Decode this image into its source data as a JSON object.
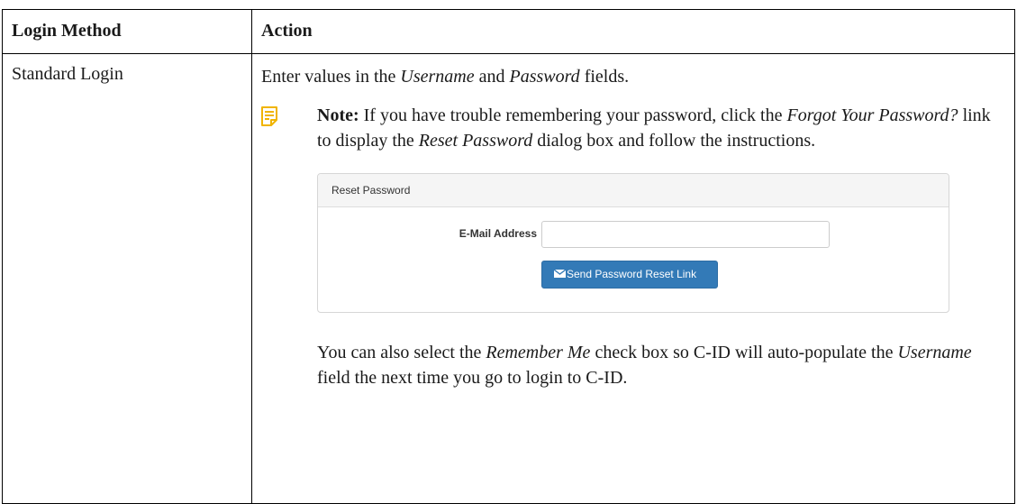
{
  "table": {
    "headers": [
      "Login Method",
      "Action"
    ],
    "row": {
      "method": "Standard Login",
      "intro": {
        "t1": "Enter values in the ",
        "e1": "Username",
        "t2": " and ",
        "e2": "Password",
        "t3": " fields."
      },
      "note": {
        "label": "Note:",
        "t1": " If you have trouble remembering your password, click the ",
        "e1": "Forgot Your Password?",
        "t2": " link to display the ",
        "e2": "Reset Password",
        "t3": " dialog box and follow the instructions."
      },
      "after": {
        "t1": "You can also select the ",
        "e1": "Remember Me",
        "t2": " check box so C-ID will auto-populate the ",
        "e2": "Username",
        "t3": " field the next time you go to login to C-ID."
      }
    }
  },
  "dialog": {
    "title": "Reset Password",
    "email_label": "E-Mail Address",
    "email_value": "",
    "send_button": "Send Password Reset Link"
  },
  "colors": {
    "note_icon": "#f0b400",
    "button_blue": "#337ab7"
  },
  "icons": {
    "note": "note-icon",
    "button": "envelope-icon"
  }
}
